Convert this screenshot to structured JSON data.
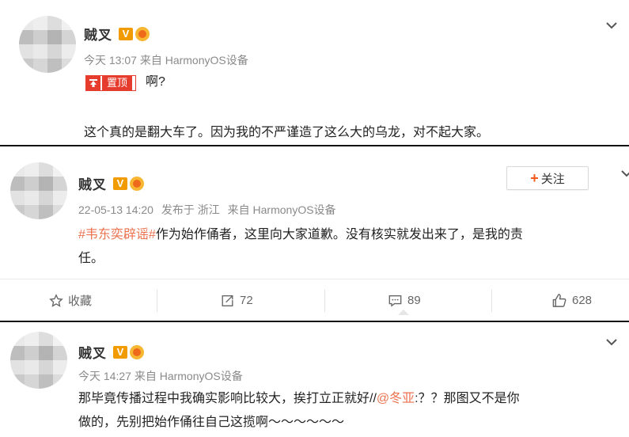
{
  "posts": [
    {
      "username": "贼叉",
      "vip_badge": "V",
      "meta": "今天 13:07 来自 HarmonyOS设备",
      "pinned_label": "置顶",
      "pinned_text": "啊?",
      "text": "这个真的是翻大车了。因为我的不严谨造了这么大的乌龙，对不起大家。"
    },
    {
      "username": "贼叉",
      "vip_badge": "V",
      "meta_date": "22-05-13 14:20",
      "meta_location": "发布于 浙江",
      "meta_source": "来自 HarmonyOS设备",
      "follow_label": "关注",
      "hashtag": "#韦东奕辟谣#",
      "text_line1": "作为始作俑者，这里向大家道歉。没有核实就发出来了，是我的责",
      "text_line2": "任。",
      "actions": {
        "favorite": "收藏",
        "repost": "72",
        "comment": "89",
        "like": "628"
      }
    },
    {
      "username": "贼叉",
      "vip_badge": "V",
      "meta": "今天 14:27 来自 HarmonyOS设备",
      "text_line1_a": "那毕竟传播过程中我确实影响比较大，挨打立正就好//",
      "mention": "@冬亚",
      "text_line1_b": ":？？那图又不是你",
      "text_line2": "做的，先别把始作俑往自己这揽啊～～～～～～"
    }
  ],
  "colors": {
    "accent": "#eb7350",
    "pin_red": "#e63c2e",
    "vip_orange": "#f29b00"
  },
  "icons": [
    "chevron-down-icon",
    "pin-icon",
    "star-icon",
    "repost-icon",
    "comment-icon",
    "like-icon",
    "medal-icon"
  ]
}
